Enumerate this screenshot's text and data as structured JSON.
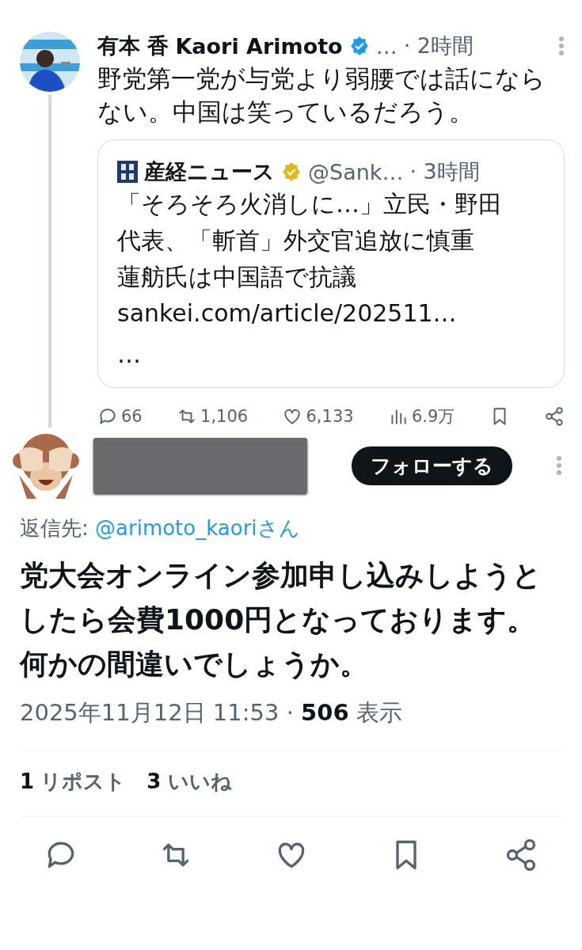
{
  "parent_tweet": {
    "author_name": "有本 香",
    "author_display": "Kaori Arimoto",
    "verified": true,
    "handle": "…",
    "time": "· 2時間",
    "text": "野党第一党が与党より弱腰では話にならない。中国は笑っているだろう。",
    "quote": {
      "author_name": "産経ニュース",
      "verified": true,
      "handle": "@Sank…",
      "time": "· 3時間",
      "lines": [
        "「そろそろ火消しに…」立民・野田",
        "代表、「斬首」外交官追放に慎重",
        "蓮舫氏は中国語で抗議",
        "sankei.com/article/202511…",
        "…"
      ]
    },
    "actions": [
      {
        "kind": "reply",
        "count": "66"
      },
      {
        "kind": "repost",
        "count": "1,106"
      },
      {
        "kind": "like",
        "count": "6,133"
      },
      {
        "kind": "views",
        "count": "6.9万"
      },
      {
        "kind": "bookmark"
      },
      {
        "kind": "share"
      }
    ]
  },
  "reply_tweet": {
    "follow_button": "フォローする",
    "reply_to_label": "返信先:",
    "reply_to_handle": "@arimoto_kaori",
    "reply_to_suffix": "さん",
    "text": "党大会オンライン参加申し込みしようとしたら会費1000円となっております。何かの間違いでしょうか。",
    "timestamp": "2025年11月12日 11:53",
    "separator": "·",
    "views": "506",
    "views_label": "表示",
    "stats": [
      {
        "count": "1",
        "label": "リポスト"
      },
      {
        "count": "3",
        "label": "いいね"
      }
    ],
    "actions": [
      {
        "kind": "reply"
      },
      {
        "kind": "repost"
      },
      {
        "kind": "like"
      },
      {
        "kind": "bookmark"
      },
      {
        "kind": "share"
      }
    ]
  }
}
